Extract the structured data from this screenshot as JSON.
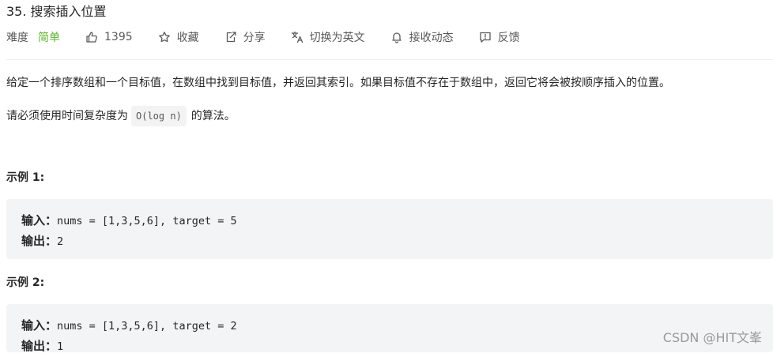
{
  "problem": {
    "title": "35. 搜索插入位置"
  },
  "meta": {
    "difficulty_label": "难度",
    "difficulty_value": "简单",
    "likes": "1395",
    "favorite": "收藏",
    "share": "分享",
    "translate": "切换为英文",
    "subscribe": "接收动态",
    "feedback": "反馈"
  },
  "description": {
    "main": "给定一个排序数组和一个目标值，在数组中找到目标值，并返回其索引。如果目标值不存在于数组中，返回它将会被按顺序插入的位置。",
    "requirement_prefix": "请必须使用时间复杂度为",
    "requirement_code": "O(log n)",
    "requirement_suffix": "的算法。"
  },
  "examples": [
    {
      "title": "示例 1:",
      "input_label": "输入：",
      "input_value": "nums = [1,3,5,6], target = 5",
      "output_label": "输出：",
      "output_value": "2"
    },
    {
      "title": "示例 2:",
      "input_label": "输入：",
      "input_value": "nums = [1,3,5,6], target = 2",
      "output_label": "输出：",
      "output_value": "1"
    }
  ],
  "watermark": "CSDN @HIT文峯",
  "colors": {
    "difficulty_easy": "#5ab726",
    "code_block_bg": "#f3f4f5"
  },
  "icons": [
    "thumbs-up-icon",
    "star-icon",
    "share-icon",
    "translate-icon",
    "bell-icon",
    "feedback-icon"
  ]
}
